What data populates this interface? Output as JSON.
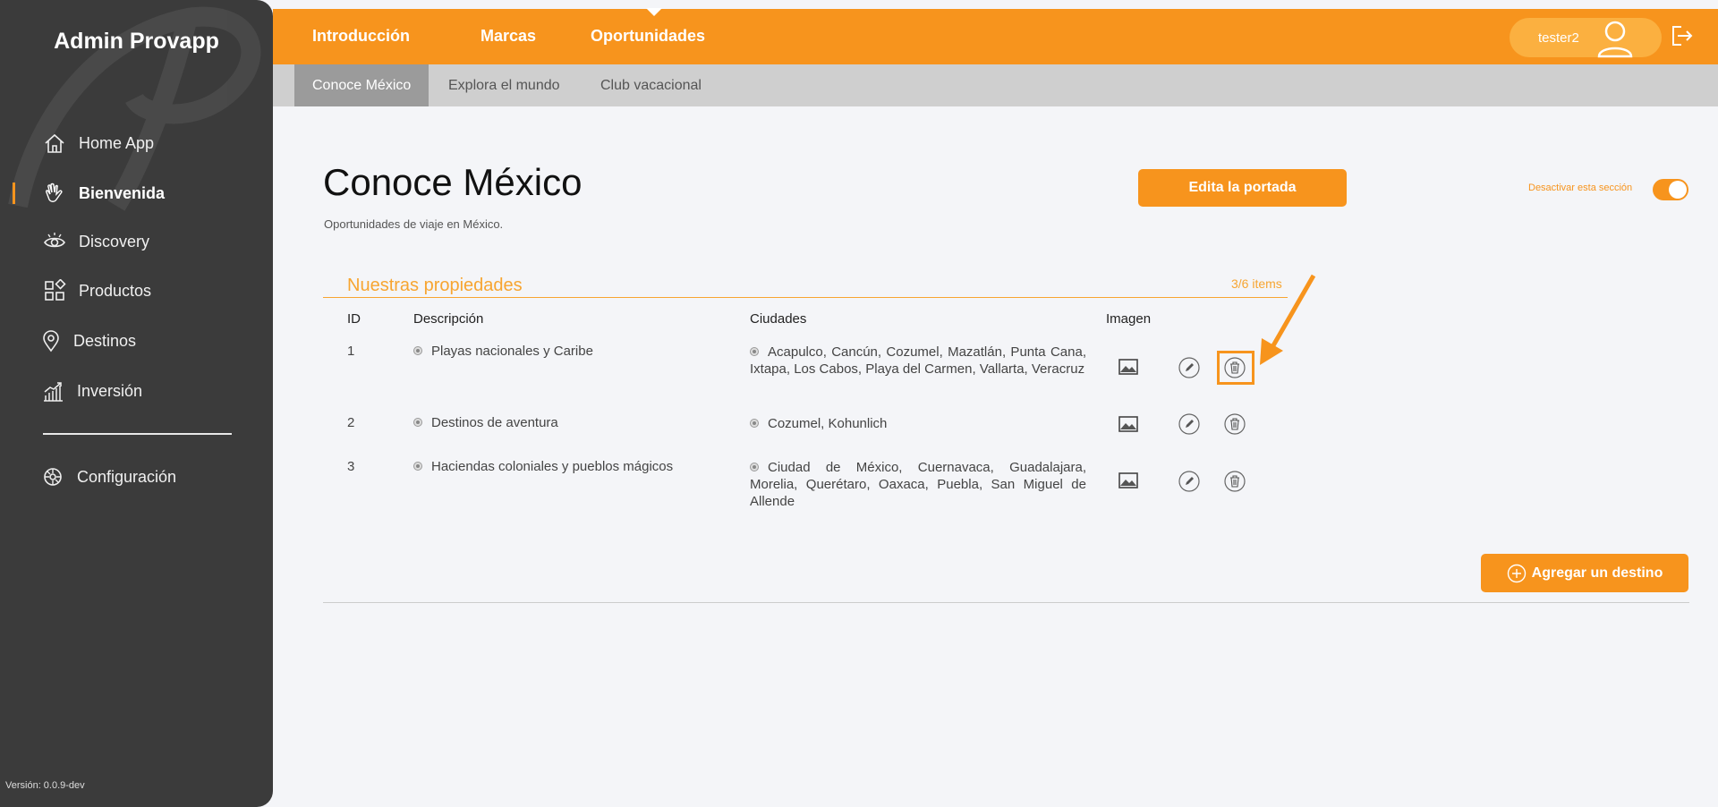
{
  "app": {
    "brand": "Admin Provapp",
    "version": "Versión: 0.0.9-dev"
  },
  "sidebar": {
    "items": [
      {
        "label": "Home App",
        "icon": "home-icon"
      },
      {
        "label": "Bienvenida",
        "icon": "waving-hand-icon",
        "active": true
      },
      {
        "label": "Discovery",
        "icon": "eye-icon"
      },
      {
        "label": "Productos",
        "icon": "grid-icon"
      },
      {
        "label": "Destinos",
        "icon": "location-pin-icon"
      },
      {
        "label": "Inversión",
        "icon": "bar-chart-icon"
      }
    ],
    "config": {
      "label": "Configuración",
      "icon": "gear-icon"
    }
  },
  "topbar": {
    "tabs": [
      "Introducción",
      "Marcas",
      "Oportunidades"
    ],
    "active_tab": "Oportunidades",
    "user": "tester2"
  },
  "subbar": {
    "tabs": [
      "Conoce México",
      "Explora el mundo",
      "Club vacacional"
    ],
    "active_tab": "Conoce México"
  },
  "main": {
    "title": "Conoce México",
    "subtitle": "Oportunidades de viaje en México.",
    "edit_cover_button": "Edita la portada",
    "toggle_label": "Desactivar esta sección",
    "toggle_on": true,
    "section_title": "Nuestras propiedades",
    "section_count": "3/6 items",
    "columns": {
      "id": "ID",
      "description": "Descripción",
      "cities": "Ciudades",
      "image": "Imagen"
    },
    "rows": [
      {
        "id": "1",
        "description": "Playas nacionales y Caribe",
        "cities": "Acapulco, Cancún, Cozumel, Mazatlán, Punta Cana, Ixtapa, Los Cabos, Playa del Carmen, Vallarta, Veracruz"
      },
      {
        "id": "2",
        "description": "Destinos de aventura",
        "cities": "Cozumel, Kohunlich"
      },
      {
        "id": "3",
        "description": "Haciendas coloniales y pueblos mágicos",
        "cities": "Ciudad de México, Cuernavaca, Guadalajara, Morelia, Querétaro, Oaxaca, Puebla, San Miguel de Allende"
      }
    ],
    "add_button": "Agregar un destino"
  },
  "colors": {
    "accent": "#f7941d",
    "sidebar": "#3b3b3b",
    "subbar": "#cfcfcf"
  }
}
